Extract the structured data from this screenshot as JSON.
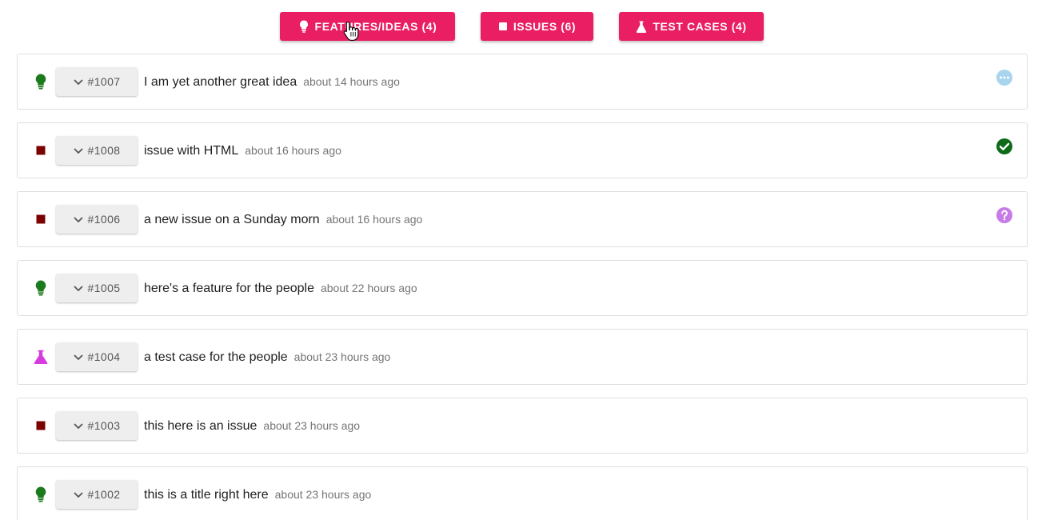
{
  "filters": {
    "features": {
      "label": "FEATURES/IDEAS (4)",
      "icon": "lightbulb-icon"
    },
    "issues": {
      "label": "ISSUES (6)",
      "icon": "square-icon"
    },
    "tests": {
      "label": "TEST CASES (4)",
      "icon": "flask-icon"
    }
  },
  "colors": {
    "accent": "#e91e63",
    "feature": "#1b7a1b",
    "issue": "#7b0000",
    "test": "#d63be0",
    "status_pending": "#a8d4ee",
    "status_done": "#0f6b1a",
    "status_question": "#c77be6"
  },
  "items": [
    {
      "type": "feature",
      "id": "#1007",
      "title": "I am yet another great idea",
      "time": "about 14 hours ago",
      "status": "pending"
    },
    {
      "type": "issue",
      "id": "#1008",
      "title": "issue with HTML",
      "time": "about 16 hours ago",
      "status": "done"
    },
    {
      "type": "issue",
      "id": "#1006",
      "title": "a new issue on a Sunday morn",
      "time": "about 16 hours ago",
      "status": "question"
    },
    {
      "type": "feature",
      "id": "#1005",
      "title": "here's a feature for the people",
      "time": "about 22 hours ago",
      "status": ""
    },
    {
      "type": "test",
      "id": "#1004",
      "title": "a test case for the people",
      "time": "about 23 hours ago",
      "status": ""
    },
    {
      "type": "issue",
      "id": "#1003",
      "title": "this here is an issue",
      "time": "about 23 hours ago",
      "status": ""
    },
    {
      "type": "feature",
      "id": "#1002",
      "title": "this is a title right here",
      "time": "about 23 hours ago",
      "status": ""
    }
  ]
}
